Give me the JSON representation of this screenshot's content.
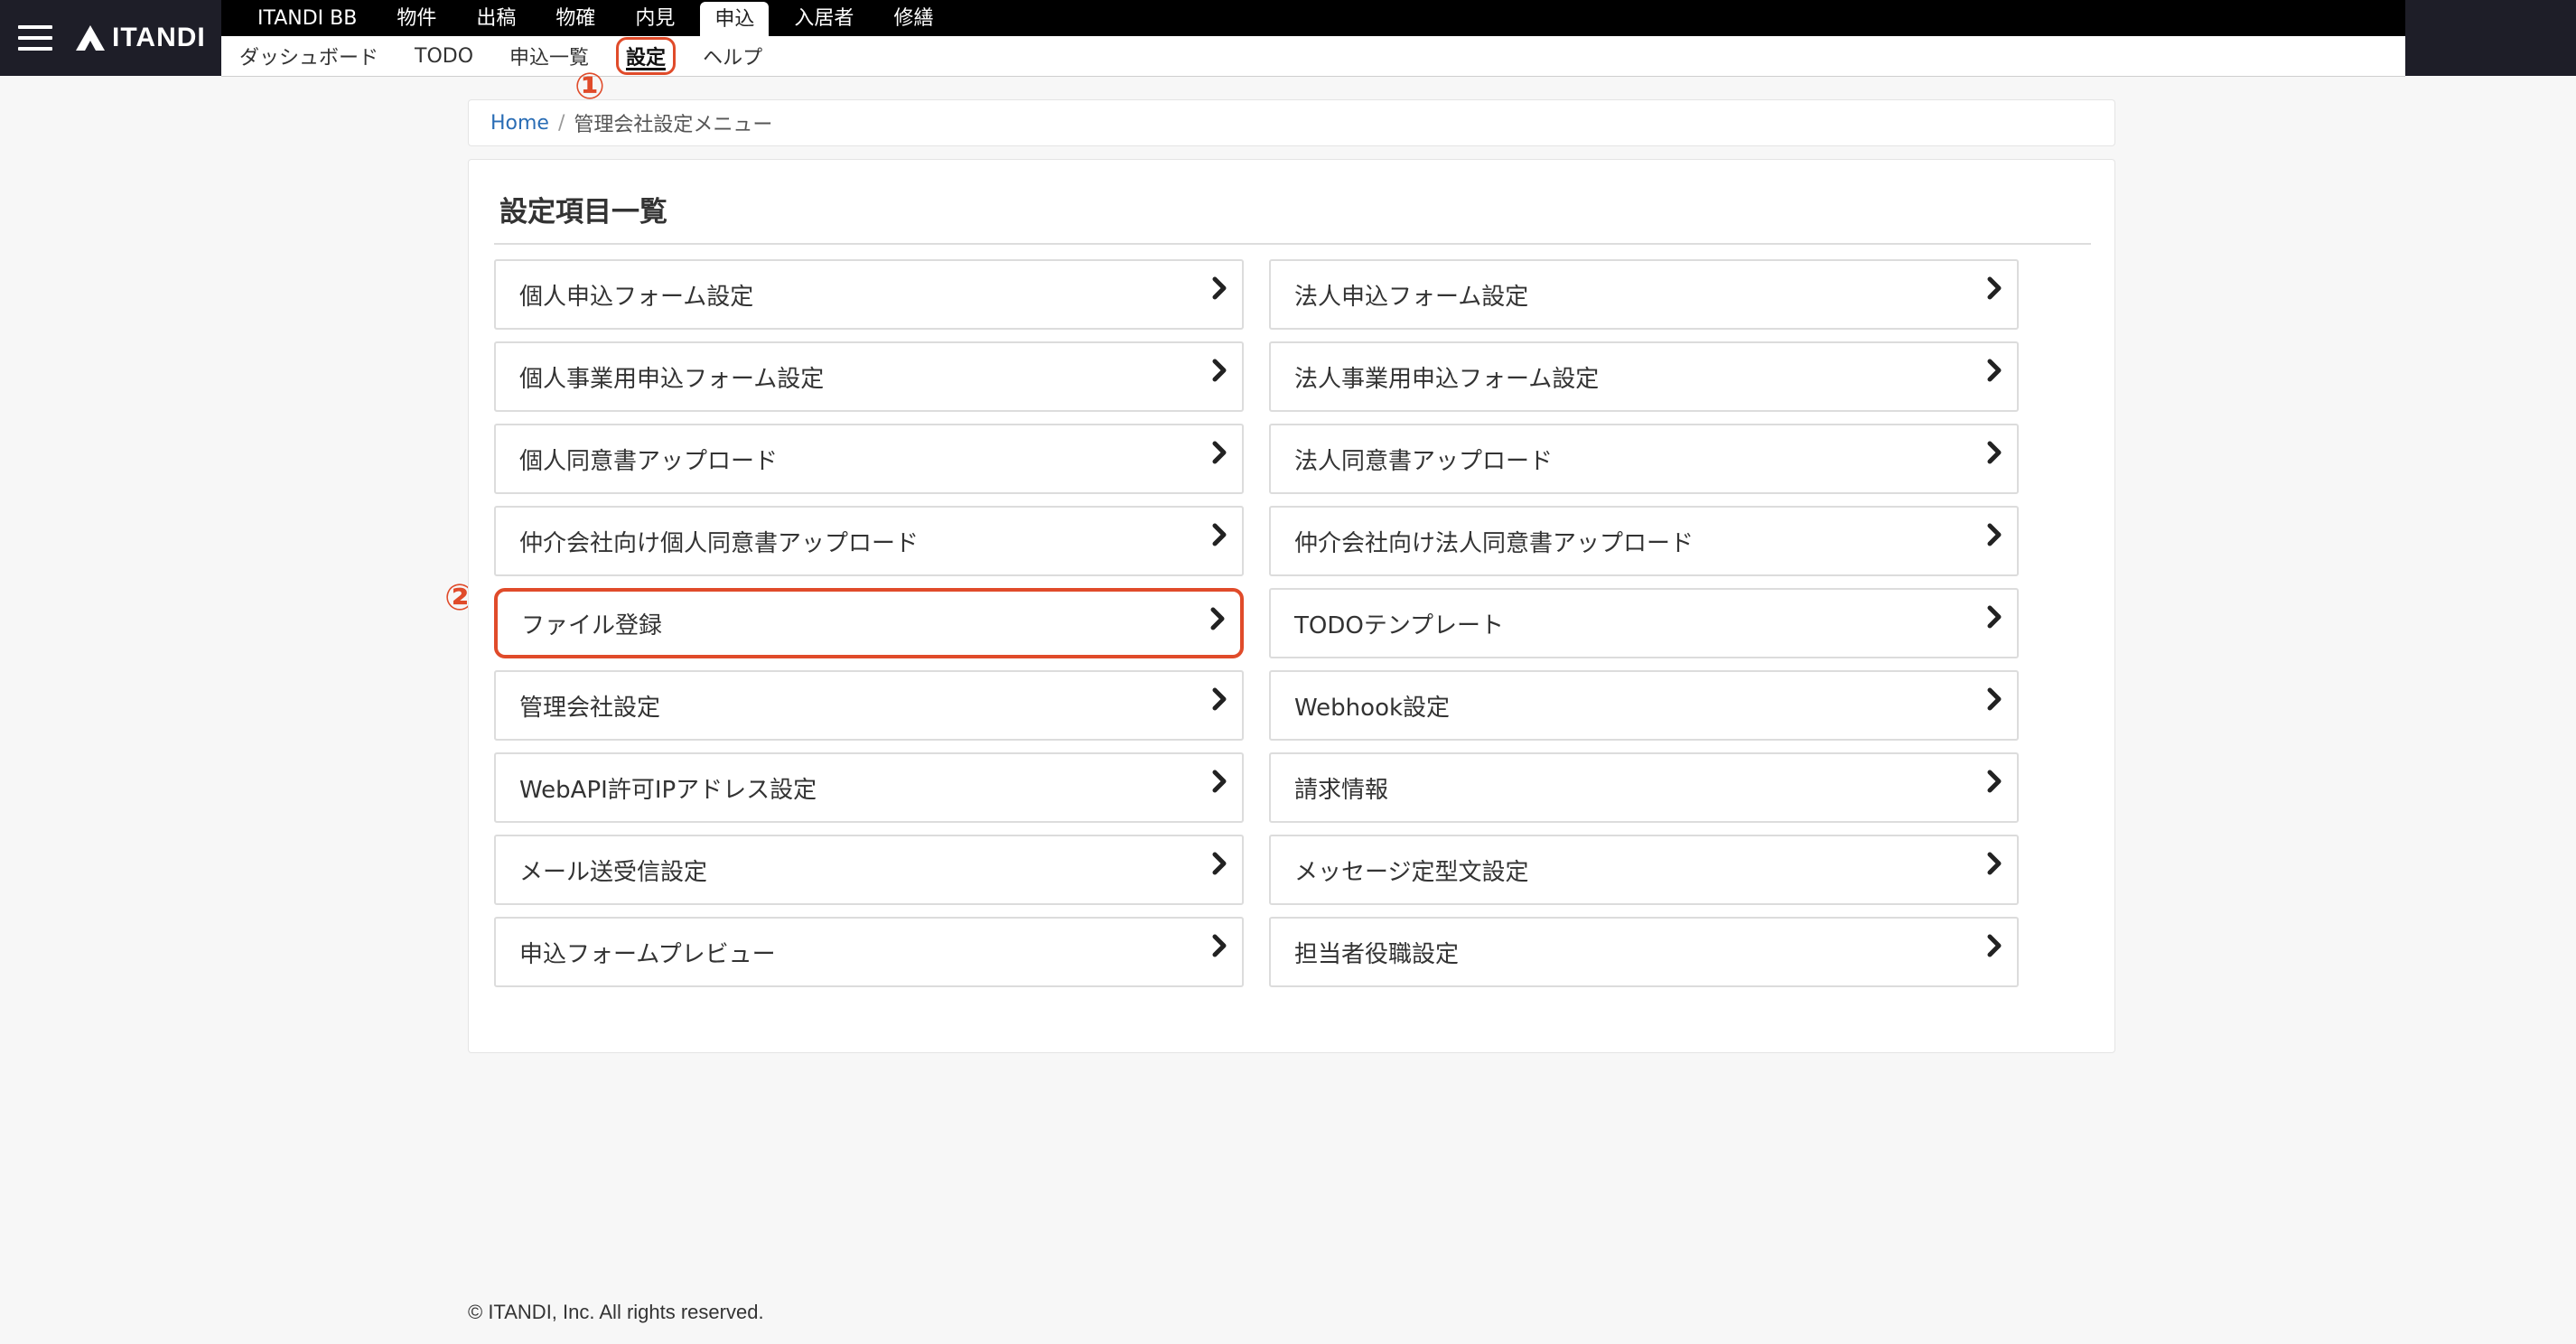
{
  "brand": {
    "logo_text": "ITANDI"
  },
  "top_nav": {
    "tabs": [
      {
        "label": "ITANDI BB",
        "active": false
      },
      {
        "label": "物件",
        "active": false
      },
      {
        "label": "出稿",
        "active": false
      },
      {
        "label": "物確",
        "active": false
      },
      {
        "label": "内見",
        "active": false
      },
      {
        "label": "申込",
        "active": true
      },
      {
        "label": "入居者",
        "active": false
      },
      {
        "label": "修繕",
        "active": false
      }
    ]
  },
  "sub_nav": {
    "items": [
      {
        "label": "ダッシュボード",
        "active": false
      },
      {
        "label": "TODO",
        "active": false
      },
      {
        "label": "申込一覧",
        "active": false
      },
      {
        "label": "設定",
        "active": true
      },
      {
        "label": "ヘルプ",
        "active": false
      }
    ]
  },
  "annotations": {
    "marker_1": "①",
    "marker_2": "②"
  },
  "breadcrumb": {
    "home": "Home",
    "separator": "/",
    "current": "管理会社設定メニュー"
  },
  "panel": {
    "title": "設定項目一覧",
    "items": [
      {
        "label": "個人申込フォーム設定",
        "highlight": false
      },
      {
        "label": "法人申込フォーム設定",
        "highlight": false
      },
      {
        "label": "個人事業用申込フォーム設定",
        "highlight": false
      },
      {
        "label": "法人事業用申込フォーム設定",
        "highlight": false
      },
      {
        "label": "個人同意書アップロード",
        "highlight": false
      },
      {
        "label": "法人同意書アップロード",
        "highlight": false
      },
      {
        "label": "仲介会社向け個人同意書アップロード",
        "highlight": false
      },
      {
        "label": "仲介会社向け法人同意書アップロード",
        "highlight": false
      },
      {
        "label": "ファイル登録",
        "highlight": true
      },
      {
        "label": "TODOテンプレート",
        "highlight": false
      },
      {
        "label": "管理会社設定",
        "highlight": false
      },
      {
        "label": "Webhook設定",
        "highlight": false
      },
      {
        "label": "WebAPI許可IPアドレス設定",
        "highlight": false
      },
      {
        "label": "請求情報",
        "highlight": false
      },
      {
        "label": "メール送受信設定",
        "highlight": false
      },
      {
        "label": "メッセージ定型文設定",
        "highlight": false
      },
      {
        "label": "申込フォームプレビュー",
        "highlight": false
      },
      {
        "label": "担当者役職設定",
        "highlight": false
      }
    ]
  },
  "footer": {
    "text": "© ITANDI, Inc. All rights reserved."
  },
  "colors": {
    "nav_bg": "#000000",
    "brand_bg": "#1e1e28",
    "accent_annotation": "#e04b2a",
    "link": "#2a6db5"
  }
}
